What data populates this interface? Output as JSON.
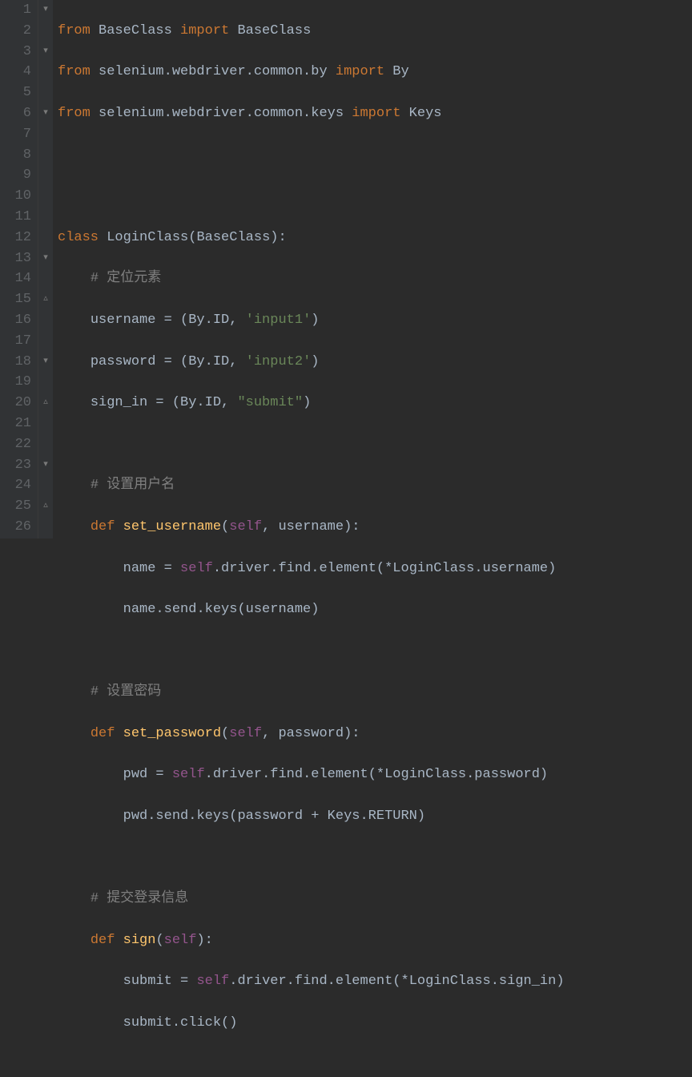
{
  "gutter": [
    "1",
    "2",
    "3",
    "4",
    "5",
    "6",
    "7",
    "8",
    "9",
    "10",
    "11",
    "12",
    "13",
    "14",
    "15",
    "16",
    "17",
    "18",
    "19",
    "20",
    "21",
    "22",
    "23",
    "24",
    "25",
    "26"
  ],
  "fold": {
    "l1": "▾",
    "l3": "▾",
    "l6": "▾",
    "l13": "▾",
    "l15": "▵",
    "l18": "▾",
    "l20": "▵",
    "l23": "▾",
    "l25": "▵"
  },
  "c": {
    "l1": {
      "from": "from",
      "mod": " BaseClass ",
      "import": "import",
      "names": " BaseClass"
    },
    "l2": {
      "from": "from",
      "mod": " selenium.webdriver.common.by ",
      "import": "import",
      "names": " By"
    },
    "l3": {
      "from": "from",
      "mod": " selenium.webdriver.common.keys ",
      "import": "import",
      "names": " Keys"
    },
    "l6": {
      "class": "class ",
      "name": "LoginClass",
      "rest": "(BaseClass):"
    },
    "l7": {
      "comment": "# 定位元素"
    },
    "l8": {
      "var": "username = (By.ID, ",
      "str": "'input1'",
      "close": ")"
    },
    "l9": {
      "var": "password = (By.ID, ",
      "str": "'input2'",
      "close": ")"
    },
    "l10": {
      "var": "sign_in = (By.ID, ",
      "str": "\"submit\"",
      "close": ")"
    },
    "l12": {
      "comment": "# 设置用户名"
    },
    "l13": {
      "def": "def ",
      "name": "set_username",
      "open": "(",
      "self": "self",
      "rest": ", username):"
    },
    "l14": {
      "a": "name = ",
      "self": "self",
      "b": ".driver.find.element(*LoginClass.username)"
    },
    "l15": {
      "a": "name.send.keys(username)"
    },
    "l17": {
      "comment": "# 设置密码"
    },
    "l18": {
      "def": "def ",
      "name": "set_password",
      "open": "(",
      "self": "self",
      "rest": ", password):"
    },
    "l19": {
      "a": "pwd = ",
      "self": "self",
      "b": ".driver.find.element(*LoginClass.password)"
    },
    "l20": {
      "a": "pwd.send.keys(password + Keys.RETURN)"
    },
    "l22": {
      "comment": "# 提交登录信息"
    },
    "l23": {
      "def": "def ",
      "name": "sign",
      "open": "(",
      "self": "self",
      "rest": "):"
    },
    "l24": {
      "a": "submit = ",
      "self": "self",
      "b": ".driver.find.element(*LoginClass.sign_in)"
    },
    "l25": {
      "a": "submit.click()"
    }
  }
}
